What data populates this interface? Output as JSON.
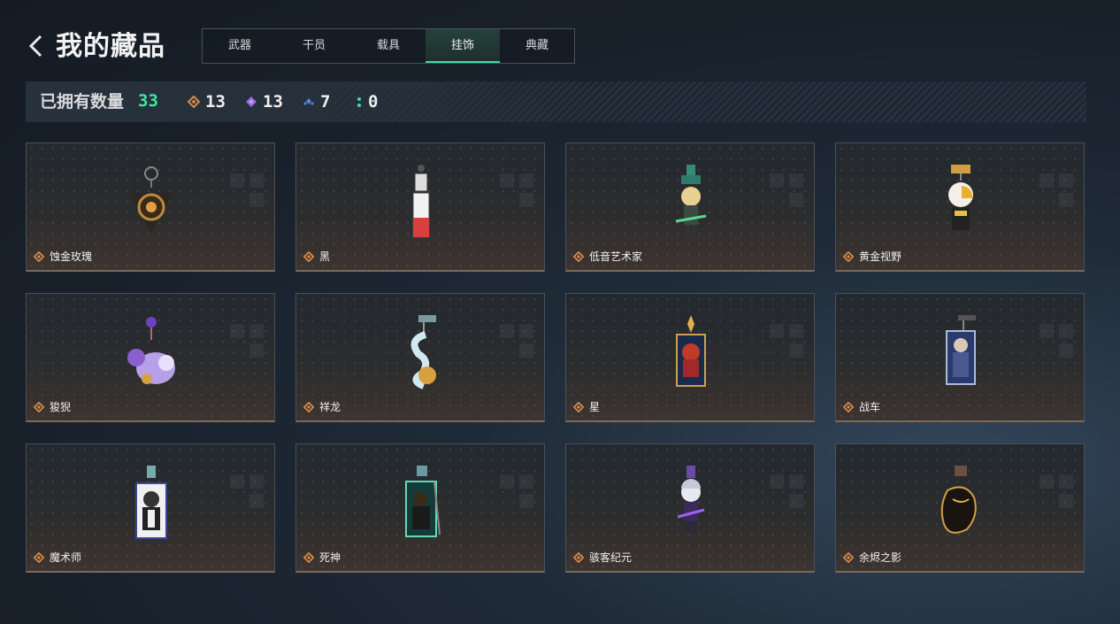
{
  "header": {
    "title": "我的藏品"
  },
  "tabs": [
    {
      "label": "武器",
      "active": false
    },
    {
      "label": "干员",
      "active": false
    },
    {
      "label": "载具",
      "active": false
    },
    {
      "label": "挂饰",
      "active": true
    },
    {
      "label": "典藏",
      "active": false
    }
  ],
  "stats": {
    "owned_label": "已拥有数量",
    "owned_count": "33",
    "rarities": [
      {
        "icon": "orange-diamond-icon",
        "color": "#d98a4a",
        "count": "13"
      },
      {
        "icon": "purple-diamond-icon",
        "color": "#9a6ad8",
        "count": "13"
      },
      {
        "icon": "blue-diamond-icon",
        "color": "#4a8ad8",
        "count": "7"
      },
      {
        "icon": "green-dots-icon",
        "color": "#3fd9a8",
        "count": "0"
      }
    ]
  },
  "items": [
    {
      "name": "蚀金玫瑰",
      "rarity": "orange",
      "art": "rose"
    },
    {
      "name": "黑",
      "rarity": "orange",
      "art": "tag"
    },
    {
      "name": "低音艺术家",
      "rarity": "orange",
      "art": "chibi-green"
    },
    {
      "name": "黄金视野",
      "rarity": "orange",
      "art": "chibi-gold"
    },
    {
      "name": "狻猊",
      "rarity": "orange",
      "art": "beast"
    },
    {
      "name": "祥龙",
      "rarity": "orange",
      "art": "dragon"
    },
    {
      "name": "星",
      "rarity": "orange",
      "art": "card-red"
    },
    {
      "name": "战车",
      "rarity": "orange",
      "art": "card-blue"
    },
    {
      "name": "魔术师",
      "rarity": "orange",
      "art": "card-white"
    },
    {
      "name": "死神",
      "rarity": "orange",
      "art": "card-green"
    },
    {
      "name": "骇客纪元",
      "rarity": "orange",
      "art": "chibi-purple"
    },
    {
      "name": "余烬之影",
      "rarity": "orange",
      "art": "ember"
    }
  ]
}
